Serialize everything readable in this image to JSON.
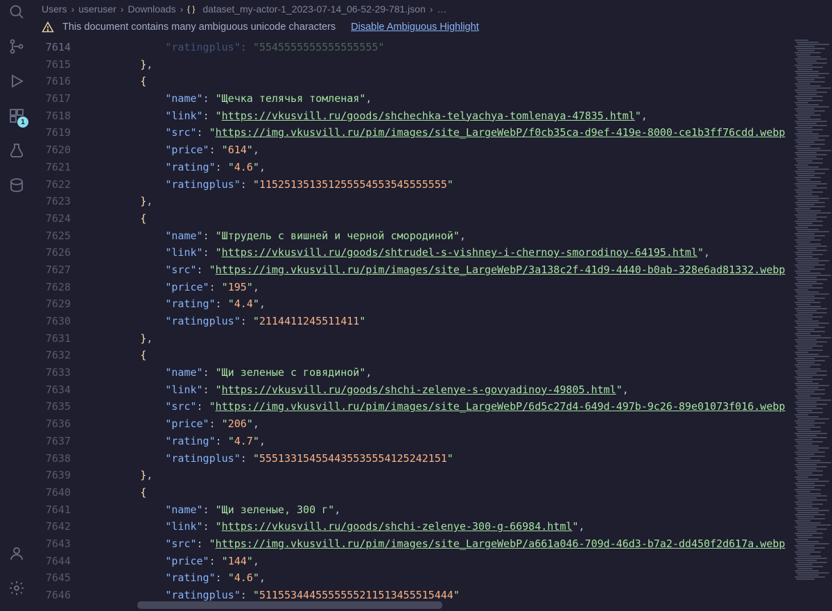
{
  "activity_bar": {
    "search": "search-icon",
    "scm": "source-control-icon",
    "run": "run-debug-icon",
    "docker": "docker-icon",
    "docker_badge": "1",
    "testing": "testing-icon",
    "db": "database-icon",
    "account": "account-icon",
    "settings": "settings-icon"
  },
  "breadcrumbs": {
    "parts": [
      "Users",
      "useruser",
      "Downloads"
    ],
    "file_icon": "json-braces-icon",
    "file": "dataset_my-actor-1_2023-07-14_06-52-29-781.json",
    "trailing": "…"
  },
  "warning": {
    "text": "This document contains many ambiguous unicode characters",
    "link_text": "Disable Ambiguous Highlight"
  },
  "gutter_start": 7614,
  "lines": [
    {
      "num": 7614,
      "ind": 6,
      "frags": [
        {
          "t": "k truncl",
          "v": "\"ratingplus\""
        },
        {
          "t": "c",
          "v": ": "
        },
        {
          "t": "s truncr",
          "v": "\"5545555555555555555\""
        }
      ]
    },
    {
      "num": 7615,
      "ind": 4,
      "frags": [
        {
          "t": "p",
          "v": "}"
        },
        {
          "t": "c",
          "v": ","
        }
      ]
    },
    {
      "num": 7616,
      "ind": 4,
      "frags": [
        {
          "t": "p",
          "v": "{"
        }
      ]
    },
    {
      "num": 7617,
      "ind": 6,
      "frags": [
        {
          "t": "k",
          "v": "\"name\""
        },
        {
          "t": "c",
          "v": ": "
        },
        {
          "t": "s",
          "v": "\"Щечка телячья томленая\""
        },
        {
          "t": "c",
          "v": ","
        }
      ]
    },
    {
      "num": 7618,
      "ind": 6,
      "frags": [
        {
          "t": "k",
          "v": "\"link\""
        },
        {
          "t": "c",
          "v": ": "
        },
        {
          "t": "s",
          "v": "\""
        },
        {
          "t": "s u",
          "v": "https://vkusvill.ru/goods/shchechka-telyachya-tomlenaya-47835.html"
        },
        {
          "t": "s",
          "v": "\""
        },
        {
          "t": "c",
          "v": ","
        }
      ]
    },
    {
      "num": 7619,
      "ind": 6,
      "frags": [
        {
          "t": "k",
          "v": "\"src\""
        },
        {
          "t": "c",
          "v": ": "
        },
        {
          "t": "s",
          "v": "\""
        },
        {
          "t": "s u",
          "v": "https://img.vkusvill.ru/pim/images/site_LargeWebP/f0cb35ca-d9ef-419e-8000-ce1b3ff76cdd.webp"
        }
      ]
    },
    {
      "num": 7620,
      "ind": 6,
      "frags": [
        {
          "t": "k",
          "v": "\"price\""
        },
        {
          "t": "c",
          "v": ": "
        },
        {
          "t": "s",
          "v": "\""
        },
        {
          "t": "n",
          "v": "614"
        },
        {
          "t": "s",
          "v": "\""
        },
        {
          "t": "c",
          "v": ","
        }
      ]
    },
    {
      "num": 7621,
      "ind": 6,
      "frags": [
        {
          "t": "k",
          "v": "\"rating\""
        },
        {
          "t": "c",
          "v": ": "
        },
        {
          "t": "s",
          "v": "\""
        },
        {
          "t": "n",
          "v": "4.6"
        },
        {
          "t": "s",
          "v": "\""
        },
        {
          "t": "c",
          "v": ","
        }
      ]
    },
    {
      "num": 7622,
      "ind": 6,
      "frags": [
        {
          "t": "k",
          "v": "\"ratingplus\""
        },
        {
          "t": "c",
          "v": ": "
        },
        {
          "t": "s",
          "v": "\""
        },
        {
          "t": "n",
          "v": "115251351351255554553545555555"
        },
        {
          "t": "s",
          "v": "\""
        }
      ]
    },
    {
      "num": 7623,
      "ind": 4,
      "frags": [
        {
          "t": "p",
          "v": "}"
        },
        {
          "t": "c",
          "v": ","
        }
      ]
    },
    {
      "num": 7624,
      "ind": 4,
      "frags": [
        {
          "t": "p",
          "v": "{"
        }
      ]
    },
    {
      "num": 7625,
      "ind": 6,
      "frags": [
        {
          "t": "k",
          "v": "\"name\""
        },
        {
          "t": "c",
          "v": ": "
        },
        {
          "t": "s",
          "v": "\"Штрудель с вишней и черной смородиной\""
        },
        {
          "t": "c",
          "v": ","
        }
      ]
    },
    {
      "num": 7626,
      "ind": 6,
      "frags": [
        {
          "t": "k",
          "v": "\"link\""
        },
        {
          "t": "c",
          "v": ": "
        },
        {
          "t": "s",
          "v": "\""
        },
        {
          "t": "s u",
          "v": "https://vkusvill.ru/goods/shtrudel-s-vishney-i-chernoy-smorodinoy-64195.html"
        },
        {
          "t": "s",
          "v": "\""
        },
        {
          "t": "c",
          "v": ","
        }
      ]
    },
    {
      "num": 7627,
      "ind": 6,
      "frags": [
        {
          "t": "k",
          "v": "\"src\""
        },
        {
          "t": "c",
          "v": ": "
        },
        {
          "t": "s",
          "v": "\""
        },
        {
          "t": "s u",
          "v": "https://img.vkusvill.ru/pim/images/site_LargeWebP/3a138c2f-41d9-4440-b0ab-328e6ad81332.webp"
        }
      ]
    },
    {
      "num": 7628,
      "ind": 6,
      "frags": [
        {
          "t": "k",
          "v": "\"price\""
        },
        {
          "t": "c",
          "v": ": "
        },
        {
          "t": "s",
          "v": "\""
        },
        {
          "t": "n",
          "v": "195"
        },
        {
          "t": "s",
          "v": "\""
        },
        {
          "t": "c",
          "v": ","
        }
      ]
    },
    {
      "num": 7629,
      "ind": 6,
      "frags": [
        {
          "t": "k",
          "v": "\"rating\""
        },
        {
          "t": "c",
          "v": ": "
        },
        {
          "t": "s",
          "v": "\""
        },
        {
          "t": "n",
          "v": "4.4"
        },
        {
          "t": "s",
          "v": "\""
        },
        {
          "t": "c",
          "v": ","
        }
      ]
    },
    {
      "num": 7630,
      "ind": 6,
      "frags": [
        {
          "t": "k",
          "v": "\"ratingplus\""
        },
        {
          "t": "c",
          "v": ": "
        },
        {
          "t": "s",
          "v": "\""
        },
        {
          "t": "n",
          "v": "2114411245511411"
        },
        {
          "t": "s",
          "v": "\""
        }
      ]
    },
    {
      "num": 7631,
      "ind": 4,
      "frags": [
        {
          "t": "p",
          "v": "}"
        },
        {
          "t": "c",
          "v": ","
        }
      ]
    },
    {
      "num": 7632,
      "ind": 4,
      "frags": [
        {
          "t": "p",
          "v": "{"
        }
      ]
    },
    {
      "num": 7633,
      "ind": 6,
      "frags": [
        {
          "t": "k",
          "v": "\"name\""
        },
        {
          "t": "c",
          "v": ": "
        },
        {
          "t": "s",
          "v": "\"Щи зеленые с говядиной\""
        },
        {
          "t": "c",
          "v": ","
        }
      ]
    },
    {
      "num": 7634,
      "ind": 6,
      "frags": [
        {
          "t": "k",
          "v": "\"link\""
        },
        {
          "t": "c",
          "v": ": "
        },
        {
          "t": "s",
          "v": "\""
        },
        {
          "t": "s u",
          "v": "https://vkusvill.ru/goods/shchi-zelenye-s-govyadinoy-49805.html"
        },
        {
          "t": "s",
          "v": "\""
        },
        {
          "t": "c",
          "v": ","
        }
      ]
    },
    {
      "num": 7635,
      "ind": 6,
      "frags": [
        {
          "t": "k",
          "v": "\"src\""
        },
        {
          "t": "c",
          "v": ": "
        },
        {
          "t": "s",
          "v": "\""
        },
        {
          "t": "s u",
          "v": "https://img.vkusvill.ru/pim/images/site_LargeWebP/6d5c27d4-649d-497b-9c26-89e01073f016.webp"
        }
      ]
    },
    {
      "num": 7636,
      "ind": 6,
      "frags": [
        {
          "t": "k",
          "v": "\"price\""
        },
        {
          "t": "c",
          "v": ": "
        },
        {
          "t": "s",
          "v": "\""
        },
        {
          "t": "n",
          "v": "206"
        },
        {
          "t": "s",
          "v": "\""
        },
        {
          "t": "c",
          "v": ","
        }
      ]
    },
    {
      "num": 7637,
      "ind": 6,
      "frags": [
        {
          "t": "k",
          "v": "\"rating\""
        },
        {
          "t": "c",
          "v": ": "
        },
        {
          "t": "s",
          "v": "\""
        },
        {
          "t": "n",
          "v": "4.7"
        },
        {
          "t": "s",
          "v": "\""
        },
        {
          "t": "c",
          "v": ","
        }
      ]
    },
    {
      "num": 7638,
      "ind": 6,
      "frags": [
        {
          "t": "k",
          "v": "\"ratingplus\""
        },
        {
          "t": "c",
          "v": ": "
        },
        {
          "t": "s",
          "v": "\""
        },
        {
          "t": "n",
          "v": "555133154554435535554125242151"
        },
        {
          "t": "s",
          "v": "\""
        }
      ]
    },
    {
      "num": 7639,
      "ind": 4,
      "frags": [
        {
          "t": "p",
          "v": "}"
        },
        {
          "t": "c",
          "v": ","
        }
      ]
    },
    {
      "num": 7640,
      "ind": 4,
      "frags": [
        {
          "t": "p",
          "v": "{"
        }
      ]
    },
    {
      "num": 7641,
      "ind": 6,
      "frags": [
        {
          "t": "k",
          "v": "\"name\""
        },
        {
          "t": "c",
          "v": ": "
        },
        {
          "t": "s",
          "v": "\"Щи зеленые, 300 г\""
        },
        {
          "t": "c",
          "v": ","
        }
      ]
    },
    {
      "num": 7642,
      "ind": 6,
      "frags": [
        {
          "t": "k",
          "v": "\"link\""
        },
        {
          "t": "c",
          "v": ": "
        },
        {
          "t": "s",
          "v": "\""
        },
        {
          "t": "s u",
          "v": "https://vkusvill.ru/goods/shchi-zelenye-300-g-66984.html"
        },
        {
          "t": "s",
          "v": "\""
        },
        {
          "t": "c",
          "v": ","
        }
      ]
    },
    {
      "num": 7643,
      "ind": 6,
      "frags": [
        {
          "t": "k",
          "v": "\"src\""
        },
        {
          "t": "c",
          "v": ": "
        },
        {
          "t": "s",
          "v": "\""
        },
        {
          "t": "s u",
          "v": "https://img.vkusvill.ru/pim/images/site_LargeWebP/a661a046-709d-46d3-b7a2-dd450f2d617a.webp"
        }
      ]
    },
    {
      "num": 7644,
      "ind": 6,
      "frags": [
        {
          "t": "k",
          "v": "\"price\""
        },
        {
          "t": "c",
          "v": ": "
        },
        {
          "t": "s",
          "v": "\""
        },
        {
          "t": "n",
          "v": "144"
        },
        {
          "t": "s",
          "v": "\""
        },
        {
          "t": "c",
          "v": ","
        }
      ]
    },
    {
      "num": 7645,
      "ind": 6,
      "frags": [
        {
          "t": "k",
          "v": "\"rating\""
        },
        {
          "t": "c",
          "v": ": "
        },
        {
          "t": "s",
          "v": "\""
        },
        {
          "t": "n",
          "v": "4.6"
        },
        {
          "t": "s",
          "v": "\""
        },
        {
          "t": "c",
          "v": ","
        }
      ]
    },
    {
      "num": 7646,
      "ind": 6,
      "frags": [
        {
          "t": "k",
          "v": "\"ratingplus\""
        },
        {
          "t": "c",
          "v": ": "
        },
        {
          "t": "s",
          "v": "\""
        },
        {
          "t": "n",
          "v": "5115534445555555211513455515444"
        },
        {
          "t": "s",
          "v": "\""
        }
      ]
    }
  ]
}
